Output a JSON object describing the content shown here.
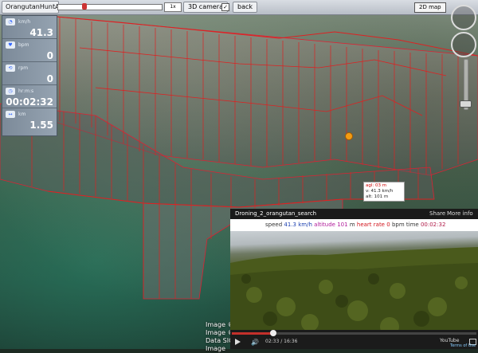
{
  "toolbar": {
    "tab_title": "OrangutanHuntAr...",
    "select_value": "1x",
    "camera_button": "3D camera",
    "back_button": "back",
    "map_button": "2D map"
  },
  "stats": [
    {
      "icon": "speedometer-icon",
      "unit": "km/h",
      "value": "41.3"
    },
    {
      "icon": "heart-rate-icon",
      "unit": "bpm",
      "value": "0"
    },
    {
      "icon": "cadence-icon",
      "unit": "rpm",
      "value": "0"
    },
    {
      "icon": "timer-icon",
      "unit": "hr:m:s",
      "value": "00:02:32"
    },
    {
      "icon": "distance-icon",
      "unit": "km",
      "value": "1.55"
    }
  ],
  "tooltip": {
    "agl": "agl: 03 m",
    "speed": "v: 41.3 km/h",
    "alt": "alt: 101 m"
  },
  "attribution": [
    "Image ©",
    "Image ©",
    "Data SIO, NOAA",
    "Image"
  ],
  "video": {
    "title": "Droning_2_orangutan_search",
    "share": "Share",
    "more_info": "More info",
    "hud": {
      "speed_label": "speed",
      "speed_value": "41.3",
      "speed_unit": "km/h",
      "altitude_label": "altitude",
      "altitude_value": "101",
      "altitude_unit": "m",
      "hr_label": "heart rate",
      "hr_value": "0",
      "hr_unit": "bpm",
      "time_label": "time",
      "time_value": "00:02:32"
    },
    "elapsed": "02:33 / 16:36",
    "logo": "YouTube",
    "terms": "Terms of Use",
    "progress_fraction": 0.17
  }
}
